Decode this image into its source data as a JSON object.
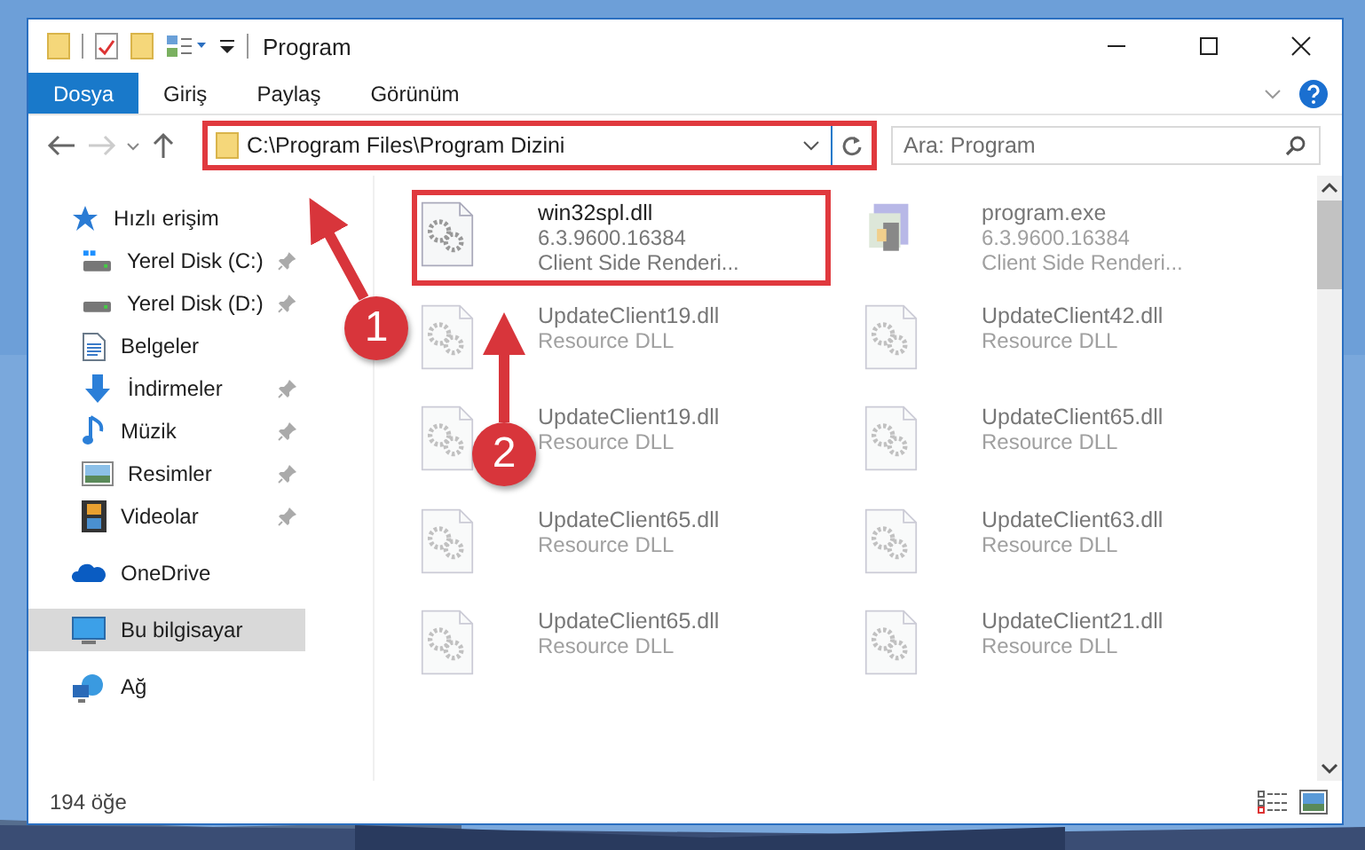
{
  "window": {
    "title": "Program"
  },
  "ribbon": {
    "tabs": [
      {
        "label": "Dosya",
        "selected": true
      },
      {
        "label": "Giriş",
        "selected": false
      },
      {
        "label": "Paylaş",
        "selected": false
      },
      {
        "label": "Görünüm",
        "selected": false
      }
    ]
  },
  "address_bar": {
    "path": "C:\\Program Files\\Program Dizini",
    "highlighted": true
  },
  "search": {
    "placeholder": "Ara: Program"
  },
  "sidebar": {
    "items": [
      {
        "label": "Hızlı erişim",
        "kind": "quick-access",
        "pinned": false,
        "selected": false
      },
      {
        "label": "Yerel Disk (C:)",
        "kind": "system-drive",
        "pinned": true,
        "selected": false
      },
      {
        "label": "Yerel Disk (D:)",
        "kind": "drive",
        "pinned": true,
        "selected": false
      },
      {
        "label": "Belgeler",
        "kind": "documents",
        "pinned": false,
        "selected": false
      },
      {
        "label": "İndirmeler",
        "kind": "downloads",
        "pinned": true,
        "selected": false
      },
      {
        "label": "Müzik",
        "kind": "music",
        "pinned": true,
        "selected": false
      },
      {
        "label": "Resimler",
        "kind": "pictures",
        "pinned": true,
        "selected": false
      },
      {
        "label": "Videolar",
        "kind": "videos",
        "pinned": true,
        "selected": false
      },
      {
        "label": "OneDrive",
        "kind": "onedrive",
        "pinned": false,
        "selected": false
      },
      {
        "label": "Bu bilgisayar",
        "kind": "pc",
        "pinned": false,
        "selected": true
      },
      {
        "label": "Ağ",
        "kind": "network",
        "pinned": false,
        "selected": false
      }
    ]
  },
  "files": [
    {
      "name": "win32spl.dll",
      "details": [
        "6.3.9600.16384",
        "Client Side Renderi..."
      ],
      "kind": "dll",
      "highlighted": true,
      "blurred": false
    },
    {
      "name": "program.exe",
      "details": [
        "6.3.9600.16384",
        "Client Side Renderi..."
      ],
      "kind": "exe",
      "highlighted": false,
      "blurred": true
    },
    {
      "name": "UpdateClient19.dll",
      "details": [
        "Resource DLL"
      ],
      "kind": "dll",
      "highlighted": false,
      "blurred": true
    },
    {
      "name": "UpdateClient42.dll",
      "details": [
        "Resource DLL"
      ],
      "kind": "dll",
      "highlighted": false,
      "blurred": true
    },
    {
      "name": "UpdateClient19.dll",
      "details": [
        "Resource DLL"
      ],
      "kind": "dll",
      "highlighted": false,
      "blurred": true
    },
    {
      "name": "UpdateClient65.dll",
      "details": [
        "Resource DLL"
      ],
      "kind": "dll",
      "highlighted": false,
      "blurred": true
    },
    {
      "name": "UpdateClient65.dll",
      "details": [
        "Resource DLL"
      ],
      "kind": "dll",
      "highlighted": false,
      "blurred": true
    },
    {
      "name": "UpdateClient63.dll",
      "details": [
        "Resource DLL"
      ],
      "kind": "dll",
      "highlighted": false,
      "blurred": true
    },
    {
      "name": "UpdateClient65.dll",
      "details": [
        "Resource DLL"
      ],
      "kind": "dll",
      "highlighted": false,
      "blurred": true
    },
    {
      "name": "UpdateClient21.dll",
      "details": [
        "Resource DLL"
      ],
      "kind": "dll",
      "highlighted": false,
      "blurred": true
    }
  ],
  "status_bar": {
    "item_count": "194 öğe"
  },
  "annotations": [
    {
      "label": "1"
    },
    {
      "label": "2"
    }
  ]
}
